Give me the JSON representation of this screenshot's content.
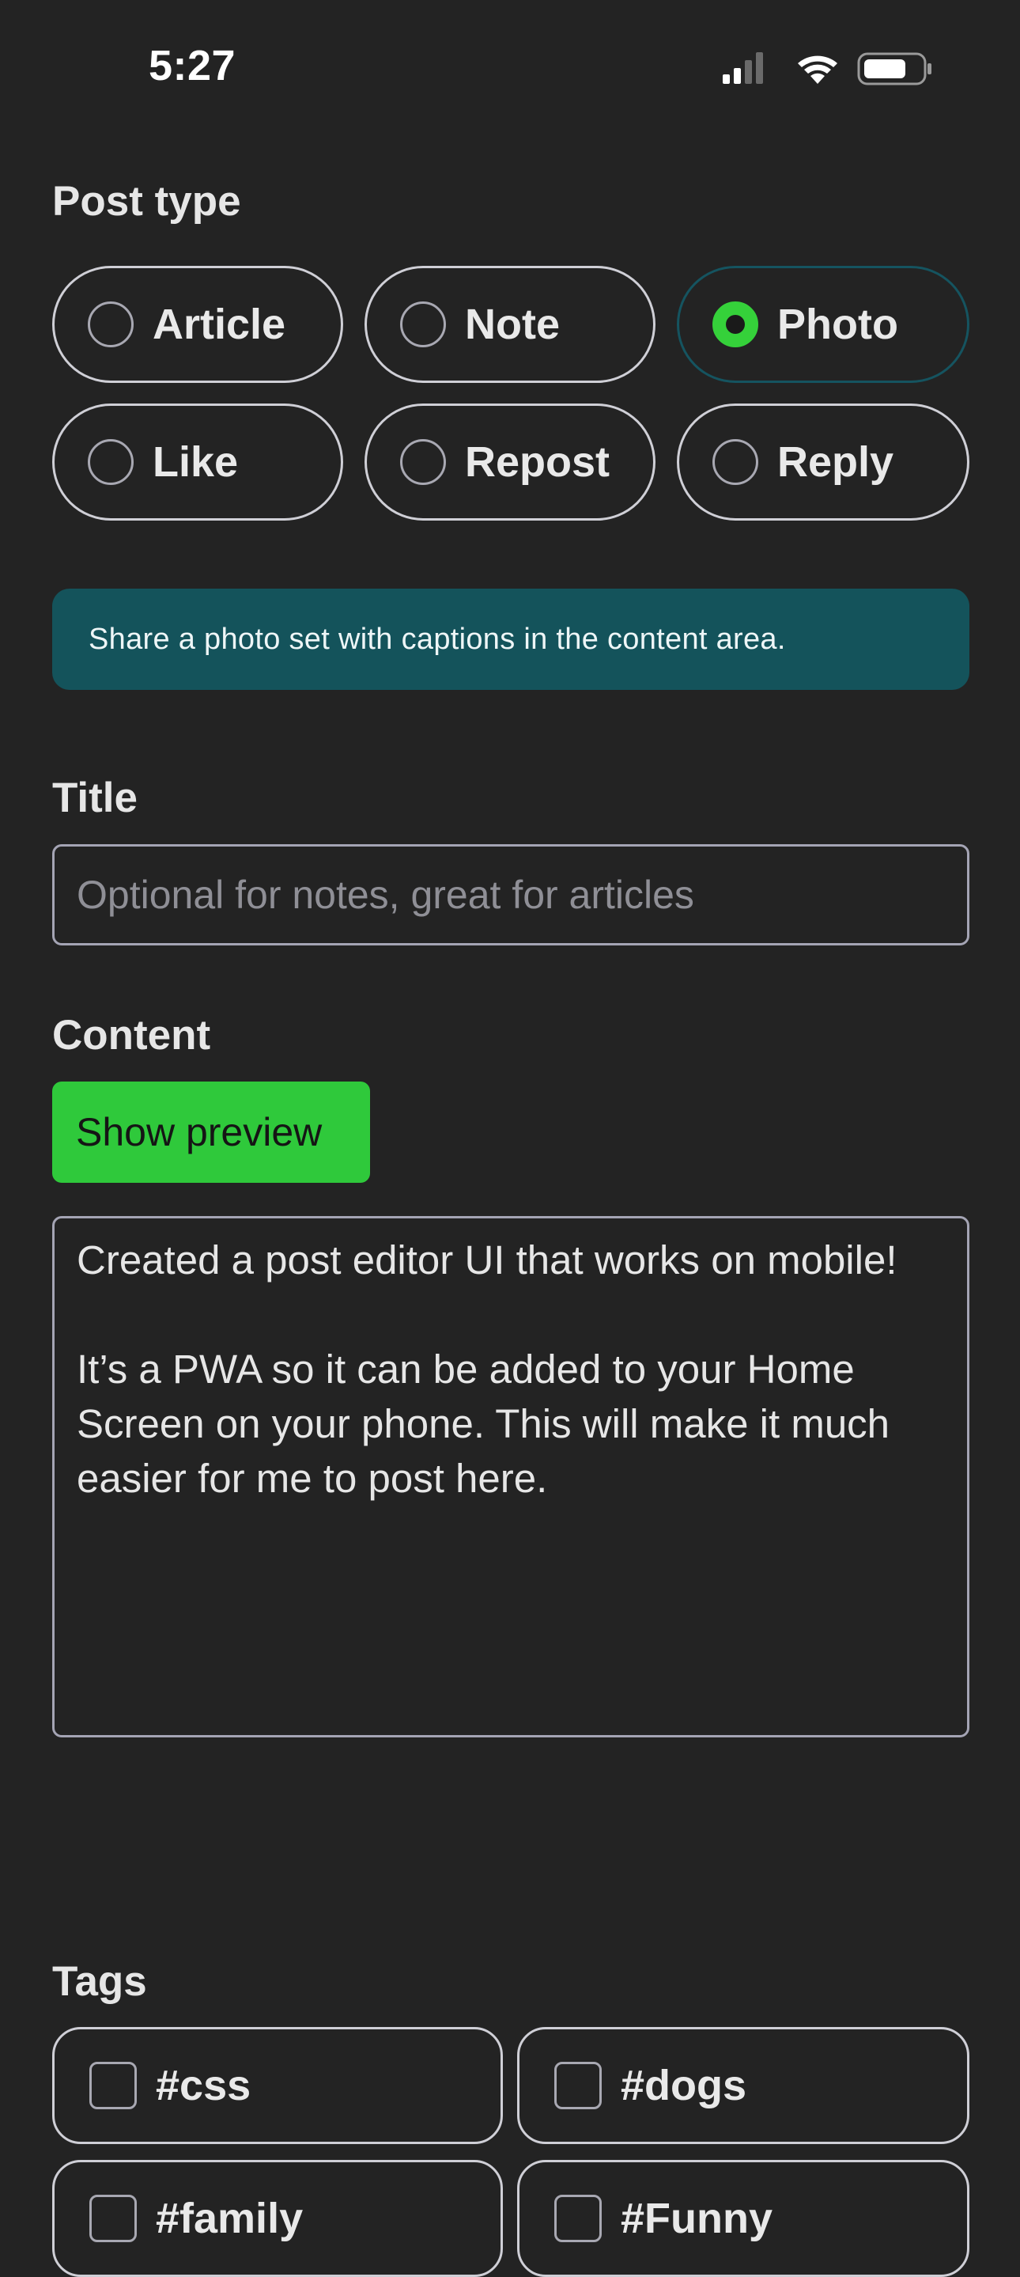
{
  "status_bar": {
    "time": "5:27",
    "icons": [
      "cellular-signal-icon",
      "wifi-icon",
      "battery-icon"
    ]
  },
  "post_type": {
    "label": "Post type",
    "options": [
      {
        "label": "Article",
        "selected": false
      },
      {
        "label": "Note",
        "selected": false
      },
      {
        "label": "Photo",
        "selected": true
      },
      {
        "label": "Like",
        "selected": false
      },
      {
        "label": "Repost",
        "selected": false
      },
      {
        "label": "Reply",
        "selected": false
      }
    ],
    "hint": "Share a photo set with captions in the content area."
  },
  "title_field": {
    "label": "Title",
    "placeholder": "Optional for notes, great for articles",
    "value": ""
  },
  "content_field": {
    "label": "Content",
    "preview_button": "Show preview",
    "value": "Created a post editor UI that works on mobile!\n\nIt’s a PWA so it can be added to your Home Screen on your phone. This will make it much easier for me to post here."
  },
  "tags": {
    "label": "Tags",
    "items": [
      {
        "label": "#css",
        "checked": false
      },
      {
        "label": "#dogs",
        "checked": false
      },
      {
        "label": "#family",
        "checked": false
      },
      {
        "label": "#Funny",
        "checked": false
      }
    ]
  },
  "colors": {
    "background": "#232323",
    "accent_green": "#2fc93b",
    "info_banner": "#14535b",
    "border": "#cfcfd6"
  }
}
